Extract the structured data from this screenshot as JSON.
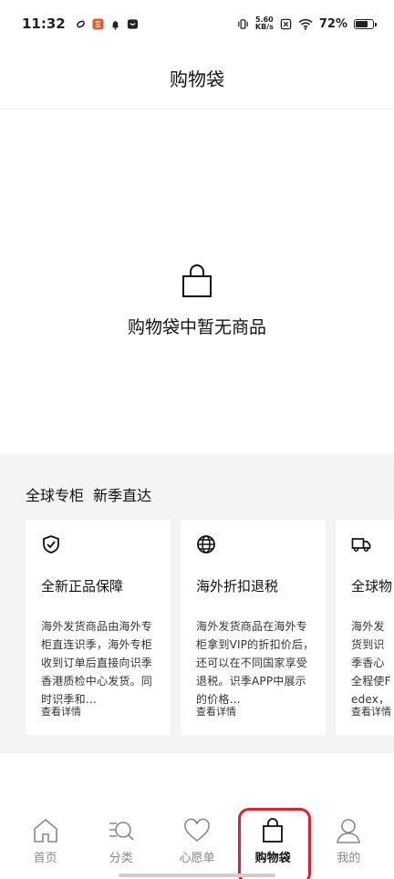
{
  "status_bar": {
    "time": "11:32",
    "net_speed_value": "5.60",
    "net_speed_unit": "KB/s",
    "battery_percent": "72%"
  },
  "header": {
    "title": "购物袋"
  },
  "empty_state": {
    "message": "购物袋中暂无商品",
    "icon": "shopping-bag-icon"
  },
  "promo": {
    "title": "全球专柜  新季直达",
    "cards": [
      {
        "icon": "shield-check-icon",
        "title": "全新正品保障",
        "body": "海外发货商品由海外专柜直连识季，海外专柜收到订单后直接向识季香港质检中心发货。同时识季和…",
        "more": "查看详情"
      },
      {
        "icon": "globe-icon",
        "title": "海外折扣退税",
        "body": "海外发货商品在海外专柜拿到VIP的折扣价后，还可以在不同国家享受退税。识季APP中展示的价格…",
        "more": "查看详情"
      },
      {
        "icon": "truck-icon",
        "title": "全球物",
        "body": "海外发货到识季香心全程使Fedex，在中国大",
        "more": "查看详情"
      }
    ]
  },
  "tabs": [
    {
      "label": "首页",
      "icon": "home-icon",
      "active": false
    },
    {
      "label": "分类",
      "icon": "category-search-icon",
      "active": false
    },
    {
      "label": "心愿单",
      "icon": "heart-icon",
      "active": false
    },
    {
      "label": "购物袋",
      "icon": "shopping-bag-icon",
      "active": true
    },
    {
      "label": "我的",
      "icon": "user-icon",
      "active": false
    }
  ],
  "colors": {
    "highlight": "#e0202c",
    "promo_bg": "#f4f4f4"
  }
}
